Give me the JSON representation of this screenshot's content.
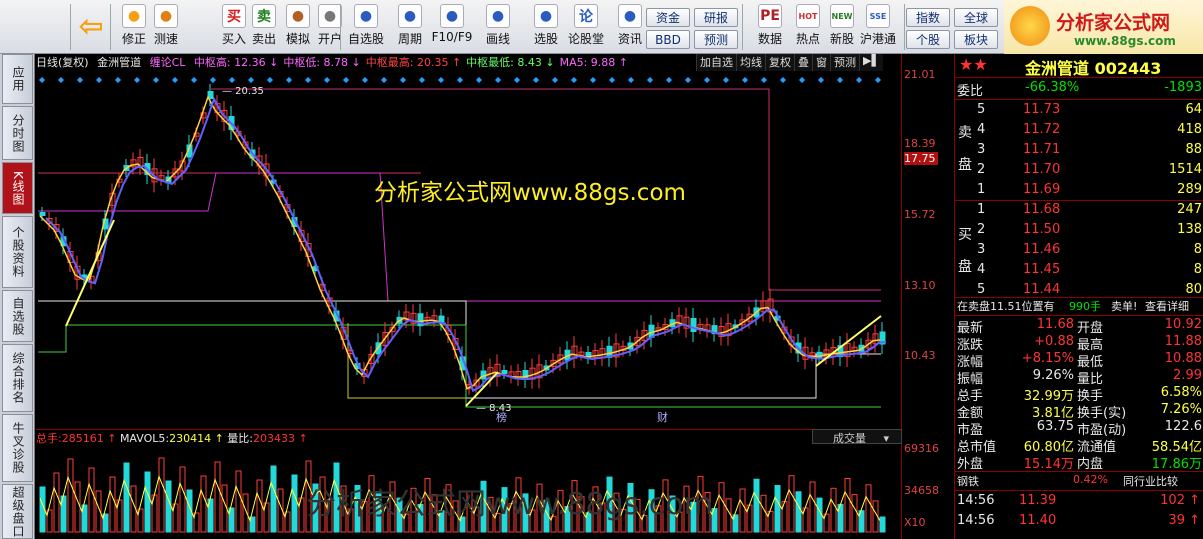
{
  "toolbar": {
    "buttons": [
      {
        "label": "",
        "icon": "back-arrow-icon"
      },
      {
        "label": "修正",
        "icon": "updown-icon"
      },
      {
        "label": "测速",
        "icon": "speedometer-icon"
      },
      {
        "label": "买入",
        "icon": "buy-icon",
        "glyph": "买"
      },
      {
        "label": "卖出",
        "icon": "sell-icon",
        "glyph": "卖"
      },
      {
        "label": "模拟",
        "icon": "gavel-icon"
      },
      {
        "label": "开户",
        "icon": "lock-icon"
      },
      {
        "label": "自选股",
        "icon": "star-icon"
      },
      {
        "label": "周期",
        "icon": "clock-icon"
      },
      {
        "label": "F10/F9",
        "icon": "f10-icon"
      },
      {
        "label": "画线",
        "icon": "pencil-icon"
      },
      {
        "label": "选股",
        "icon": "screen-icon"
      },
      {
        "label": "论股堂",
        "icon": "discuss-icon",
        "glyph": "论"
      },
      {
        "label": "资讯",
        "icon": "news-icon"
      },
      {
        "label": "数据",
        "icon": "pe-icon",
        "glyph": "PE"
      },
      {
        "label": "热点",
        "icon": "hot-icon",
        "glyph": "HOT"
      },
      {
        "label": "新股",
        "icon": "newstock-icon",
        "glyph": "NEW"
      },
      {
        "label": "沪港通",
        "icon": "sse-hkex-icon",
        "glyph": "SSE"
      }
    ],
    "small_buttons": [
      "资金",
      "研报",
      "BBD",
      "预测",
      "指数",
      "全球",
      "个股",
      "板块"
    ],
    "logo_text": "分析家公式网",
    "logo_url": "www.88gs.com"
  },
  "left_tabs": [
    "应用",
    "分时图",
    "K线图",
    "个股资料",
    "自选股",
    "综合排名",
    "牛叉诊股",
    "超级盘口"
  ],
  "chart_header": {
    "period": "日线(复权)",
    "stock": "金洲管道",
    "indicator": "缠论CL",
    "items": [
      {
        "label": "中枢高:",
        "value": "12.36",
        "arrow": "↓",
        "color": "#ff66ff"
      },
      {
        "label": "中枢低:",
        "value": "8.78",
        "arrow": "↓",
        "color": "#ff66ff"
      },
      {
        "label": "中枢最高:",
        "value": "20.35",
        "arrow": "↑",
        "color": "#ff4444"
      },
      {
        "label": "中枢最低:",
        "value": "8.43",
        "arrow": "↓",
        "color": "#66ff66"
      },
      {
        "label": "MA5:",
        "value": "9.88",
        "arrow": "↑",
        "color": "#ff66ff"
      }
    ],
    "tools": [
      "加自选",
      "均线",
      "复权",
      "叠",
      "窗",
      "预测"
    ]
  },
  "price_axis": [
    "21.01",
    "18.39",
    "17.75",
    "15.72",
    "13.10",
    "10.43",
    "69316",
    "34658",
    "X10"
  ],
  "annotations": {
    "high": "20.35",
    "low": "8.43",
    "mark1": "榜",
    "mark2": "财"
  },
  "watermark": "分析家公式网www.88gs.com",
  "volume": {
    "total_label": "总手:",
    "total": "285161",
    "mavol_label": "MAVOL5:",
    "mavol": "230414",
    "ratio_label": "量比:",
    "ratio": "203433",
    "tab": "成交量"
  },
  "quote": {
    "name": "金洲管道",
    "code": "002443",
    "weibi_label": "委比",
    "weibi": "-66.38%",
    "weicha": "-1893",
    "sell_label": [
      "卖",
      "盘"
    ],
    "buy_label": [
      "买",
      "盘"
    ],
    "asks": [
      {
        "lvl": "5",
        "price": "11.73",
        "vol": "64"
      },
      {
        "lvl": "4",
        "price": "11.72",
        "vol": "418"
      },
      {
        "lvl": "3",
        "price": "11.71",
        "vol": "88"
      },
      {
        "lvl": "2",
        "price": "11.70",
        "vol": "1514"
      },
      {
        "lvl": "1",
        "price": "11.69",
        "vol": "289"
      }
    ],
    "bids": [
      {
        "lvl": "1",
        "price": "11.68",
        "vol": "247"
      },
      {
        "lvl": "2",
        "price": "11.50",
        "vol": "138"
      },
      {
        "lvl": "3",
        "price": "11.46",
        "vol": "8"
      },
      {
        "lvl": "4",
        "price": "11.45",
        "vol": "8"
      },
      {
        "lvl": "5",
        "price": "11.44",
        "vol": "80"
      }
    ],
    "notice": "在卖盘11.51位置有",
    "notice_vol": "990手",
    "notice_action": "卖单!",
    "notice_link": "查看详细",
    "stats": [
      {
        "l1": "最新",
        "v1": "11.68",
        "c1": "red",
        "l2": "开盘",
        "v2": "10.92",
        "c2": "red"
      },
      {
        "l1": "涨跌",
        "v1": "+0.88",
        "c1": "red",
        "l2": "最高",
        "v2": "11.88",
        "c2": "red"
      },
      {
        "l1": "涨幅",
        "v1": "+8.15%",
        "c1": "red",
        "l2": "最低",
        "v2": "10.88",
        "c2": "red"
      },
      {
        "l1": "振幅",
        "v1": "9.26%",
        "c1": "white",
        "l2": "量比",
        "v2": "2.99",
        "c2": "red"
      },
      {
        "l1": "总手",
        "v1": "32.99万",
        "c1": "yellow",
        "l2": "换手",
        "v2": "6.58%",
        "c2": "yellow"
      },
      {
        "l1": "金额",
        "v1": "3.81亿",
        "c1": "yellow",
        "l2": "换手(实)",
        "v2": "7.26%",
        "c2": "yellow"
      },
      {
        "l1": "市盈",
        "v1": "63.75",
        "c1": "white",
        "l2": "市盈(动)",
        "v2": "122.6",
        "c2": "white"
      },
      {
        "l1": "总市值",
        "v1": "60.80亿",
        "c1": "yellow",
        "l2": "流通值",
        "v2": "58.54亿",
        "c2": "yellow"
      },
      {
        "l1": "外盘",
        "v1": "15.14万",
        "c1": "red",
        "l2": "内盘",
        "v2": "17.86万",
        "c2": "green"
      }
    ],
    "sector": "钢铁",
    "sector_pct": "0.42%",
    "sector_btn": "同行业比较",
    "ticks": [
      {
        "time": "14:56",
        "price": "11.39",
        "vol": "102"
      },
      {
        "time": "14:56",
        "price": "11.40",
        "vol": "39"
      }
    ]
  }
}
